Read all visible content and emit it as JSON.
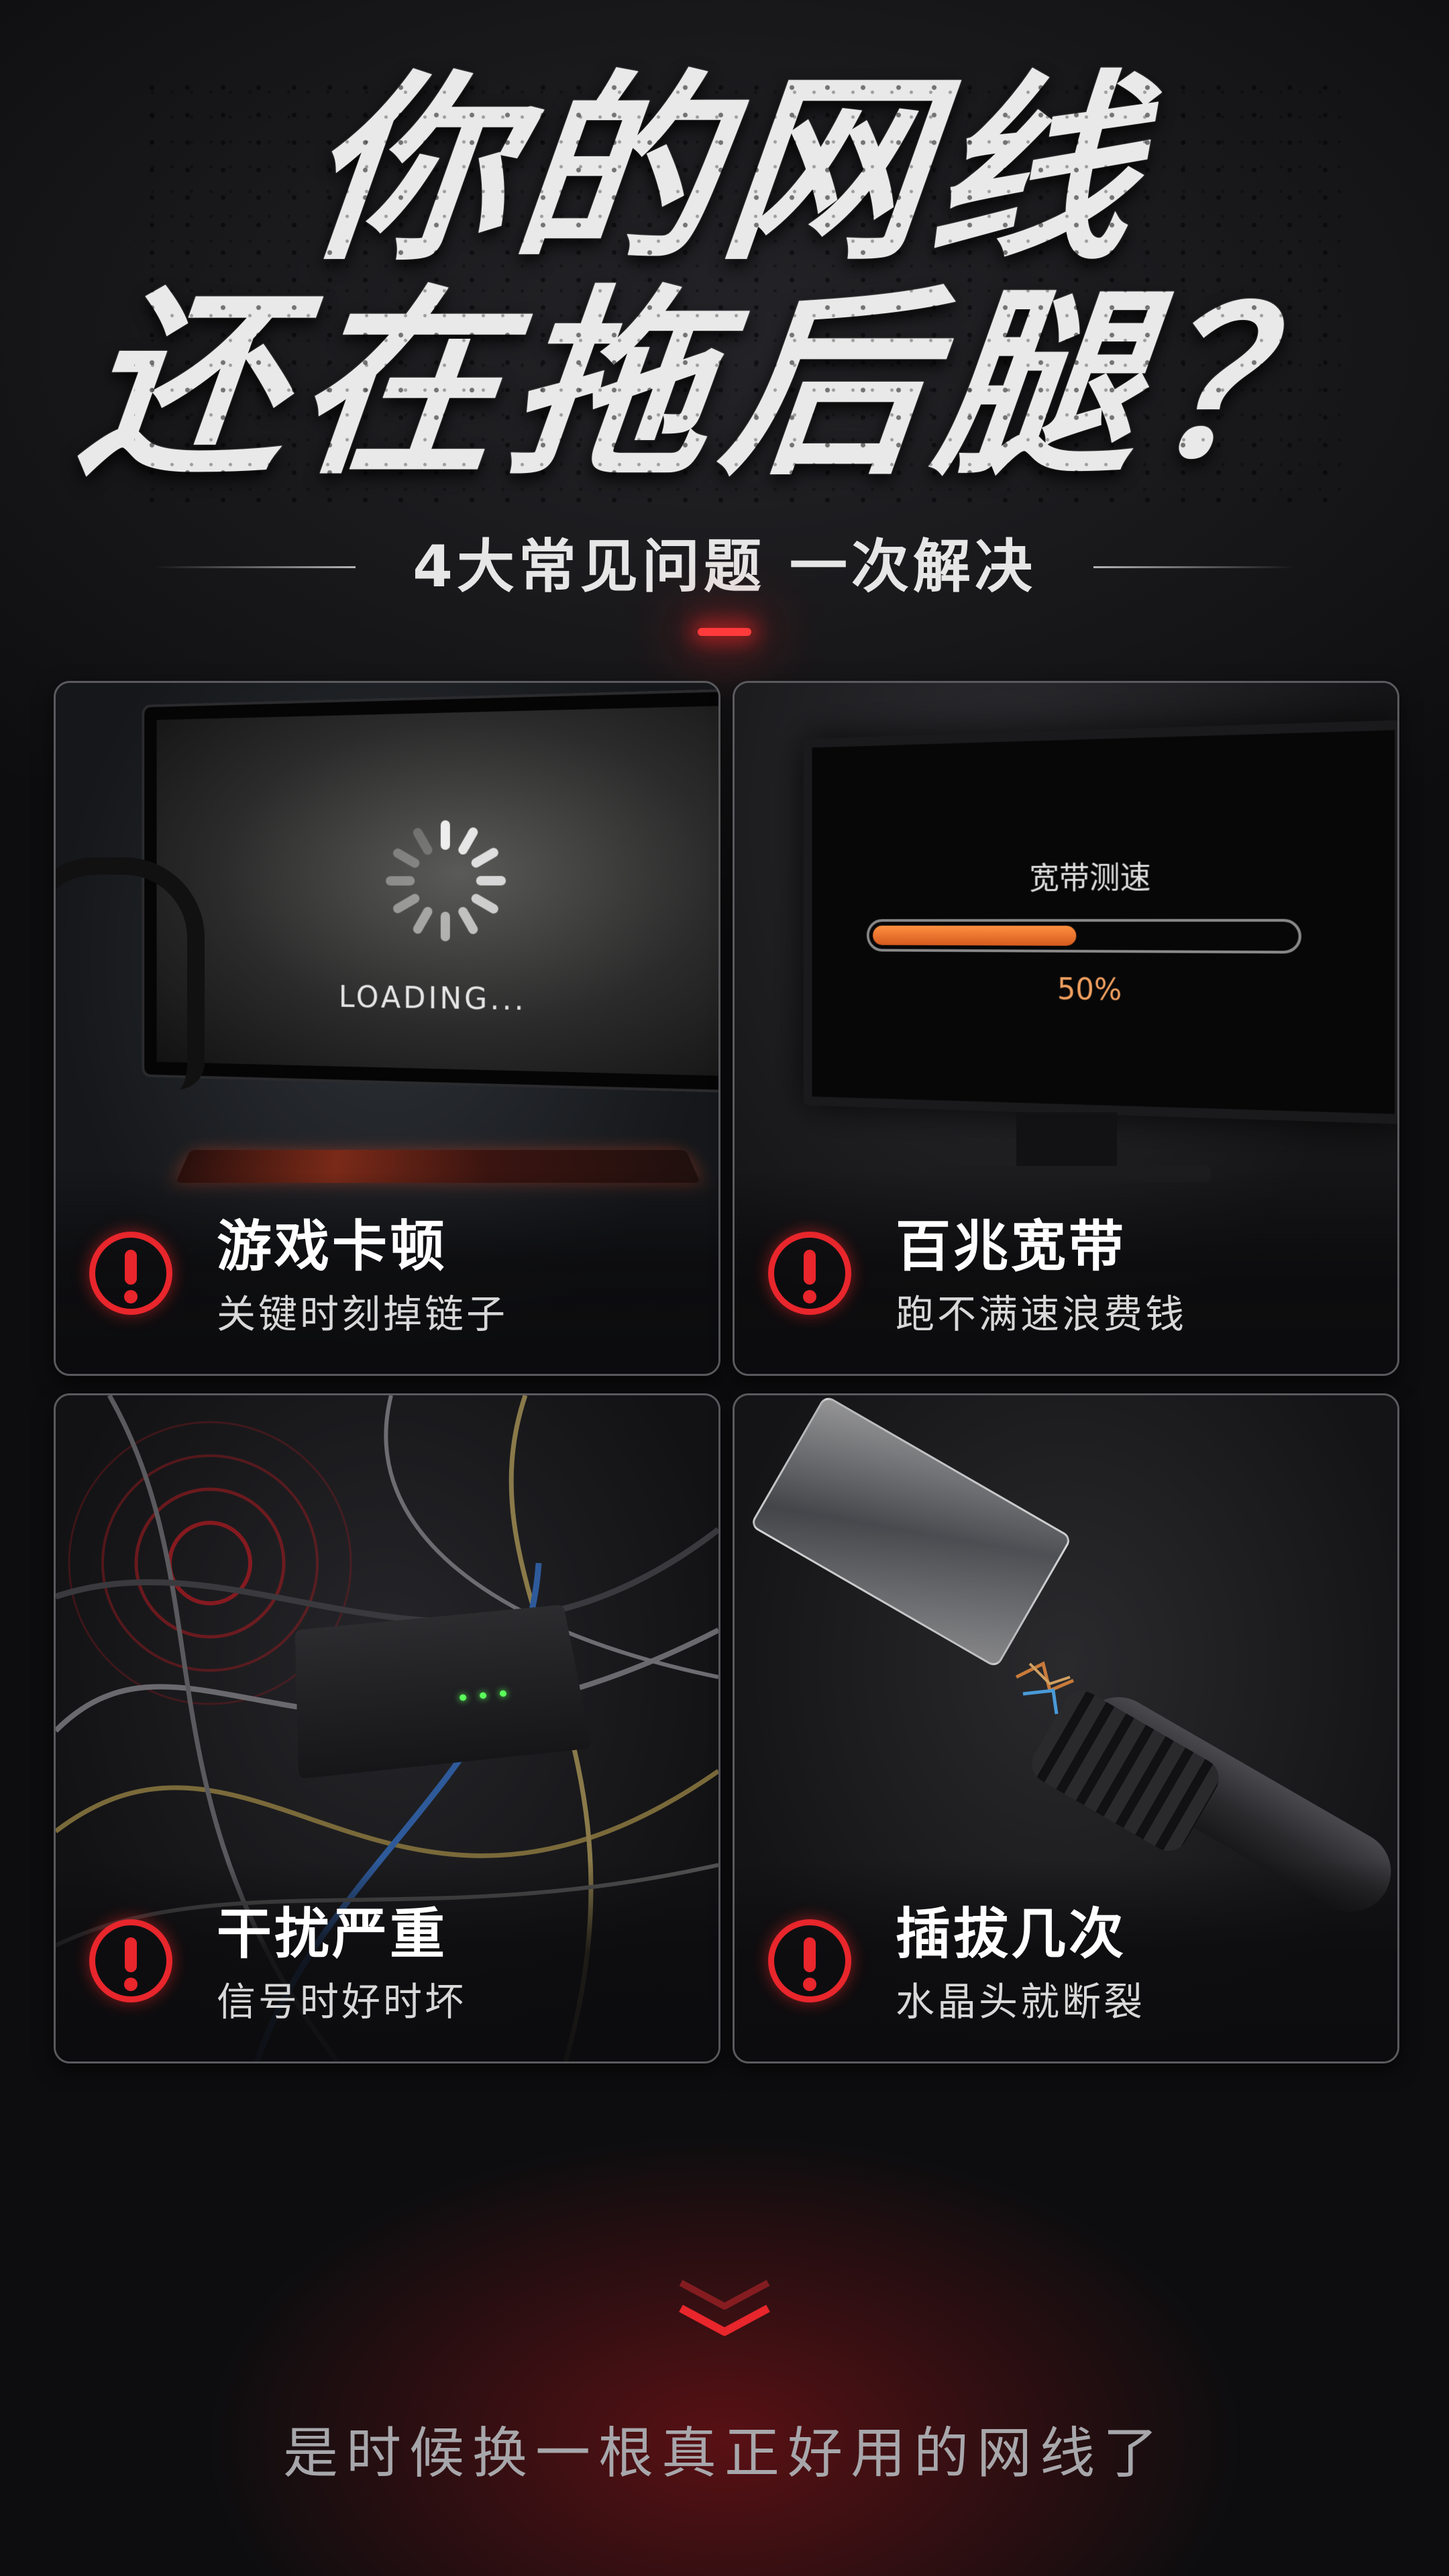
{
  "title": {
    "line1": "你的网线",
    "line2": "还在拖后腿？"
  },
  "subtitle": "4大常见问题 一次解决",
  "cards": [
    {
      "title": "游戏卡顿",
      "subtitle": "关键时刻掉链子",
      "screen_text": "LOADING..."
    },
    {
      "title": "百兆宽带",
      "subtitle": "跑不满速浪费钱",
      "screen_label": "宽带测速",
      "progress_percent_text": "50%",
      "progress_fraction": 0.5
    },
    {
      "title": "干扰严重",
      "subtitle": "信号时好时坏"
    },
    {
      "title": "插拔几次",
      "subtitle": "水晶头就断裂"
    }
  ],
  "bottom_text": "是时候换一根真正好用的网线了",
  "colors": {
    "accent_red": "#e8262c",
    "progress_orange": "#f2a060"
  }
}
